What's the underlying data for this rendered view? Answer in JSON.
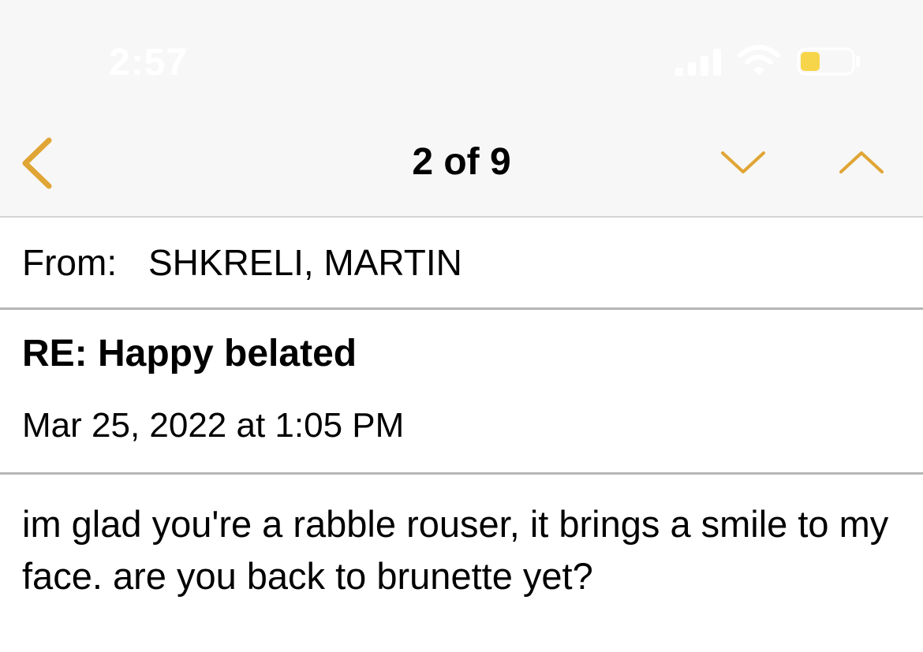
{
  "status_bar": {
    "time": "2:57"
  },
  "nav": {
    "counter": "2 of 9",
    "icons": {
      "back": "chevron-left-icon",
      "next": "chevron-down-icon",
      "previous": "chevron-up-icon"
    },
    "accent_color": "#E0A535"
  },
  "message": {
    "from_label": "From:",
    "from_name": "SHKRELI, MARTIN",
    "subject": "RE: Happy belated",
    "date": "Mar 25, 2022 at 1:05 PM",
    "body": "im glad you're a rabble rouser, it brings a smile to my face. are you back to brunette yet?"
  }
}
